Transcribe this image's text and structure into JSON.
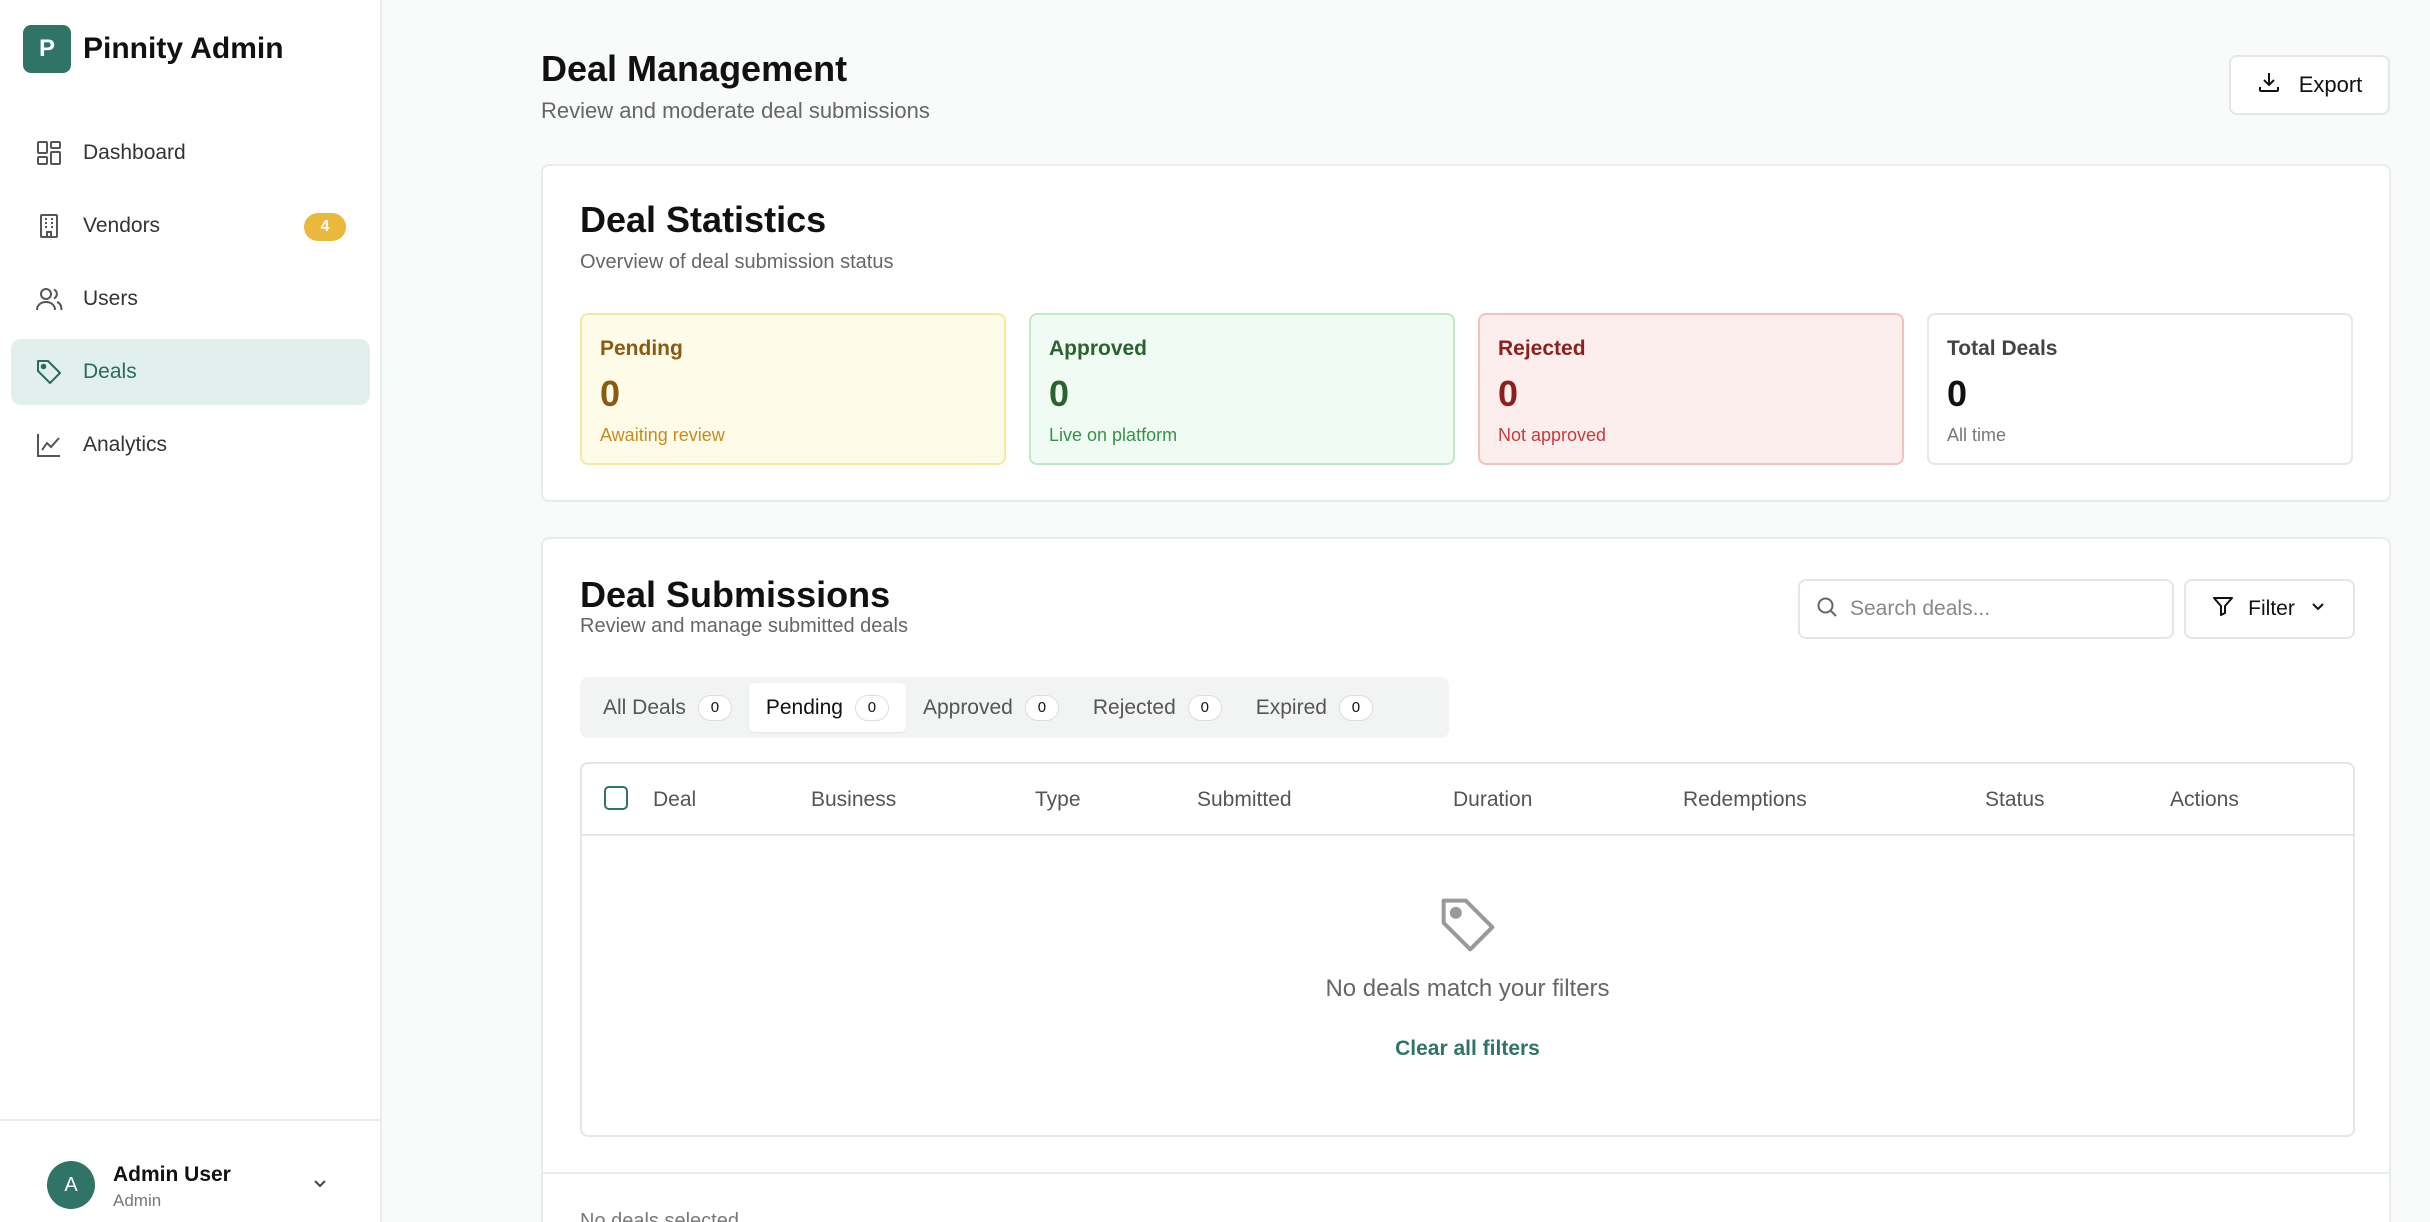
{
  "brand": {
    "logo_letter": "P",
    "name": "Pinnity Admin",
    "color": "#2f7466"
  },
  "sidebar": {
    "items": [
      {
        "label": "Dashboard",
        "icon": "dashboard-icon",
        "active": false
      },
      {
        "label": "Vendors",
        "icon": "building-icon",
        "active": false,
        "badge": "4"
      },
      {
        "label": "Users",
        "icon": "users-icon",
        "active": false
      },
      {
        "label": "Deals",
        "icon": "tag-icon",
        "active": true
      },
      {
        "label": "Analytics",
        "icon": "chart-line-icon",
        "active": false
      }
    ]
  },
  "user": {
    "initial": "A",
    "name": "Admin User",
    "role": "Admin"
  },
  "header": {
    "title": "Deal Management",
    "subtitle": "Review and moderate deal submissions",
    "export_label": "Export"
  },
  "stats": {
    "title": "Deal Statistics",
    "subtitle": "Overview of deal submission status",
    "cards": [
      {
        "label": "Pending",
        "value": "0",
        "note": "Awaiting review"
      },
      {
        "label": "Approved",
        "value": "0",
        "note": "Live on platform"
      },
      {
        "label": "Rejected",
        "value": "0",
        "note": "Not approved"
      },
      {
        "label": "Total Deals",
        "value": "0",
        "note": "All time"
      }
    ]
  },
  "submissions": {
    "title": "Deal Submissions",
    "subtitle": "Review and manage submitted deals",
    "search_placeholder": "Search deals...",
    "filter_label": "Filter",
    "tabs": [
      {
        "label": "All Deals",
        "count": "0",
        "active": false
      },
      {
        "label": "Pending",
        "count": "0",
        "active": true
      },
      {
        "label": "Approved",
        "count": "0",
        "active": false
      },
      {
        "label": "Rejected",
        "count": "0",
        "active": false
      },
      {
        "label": "Expired",
        "count": "0",
        "active": false
      }
    ],
    "columns": [
      "Deal",
      "Business",
      "Type",
      "Submitted",
      "Duration",
      "Redemptions",
      "Status",
      "Actions"
    ],
    "empty_text": "No deals match your filters",
    "clear_label": "Clear all filters",
    "footer_text": "No deals selected"
  }
}
